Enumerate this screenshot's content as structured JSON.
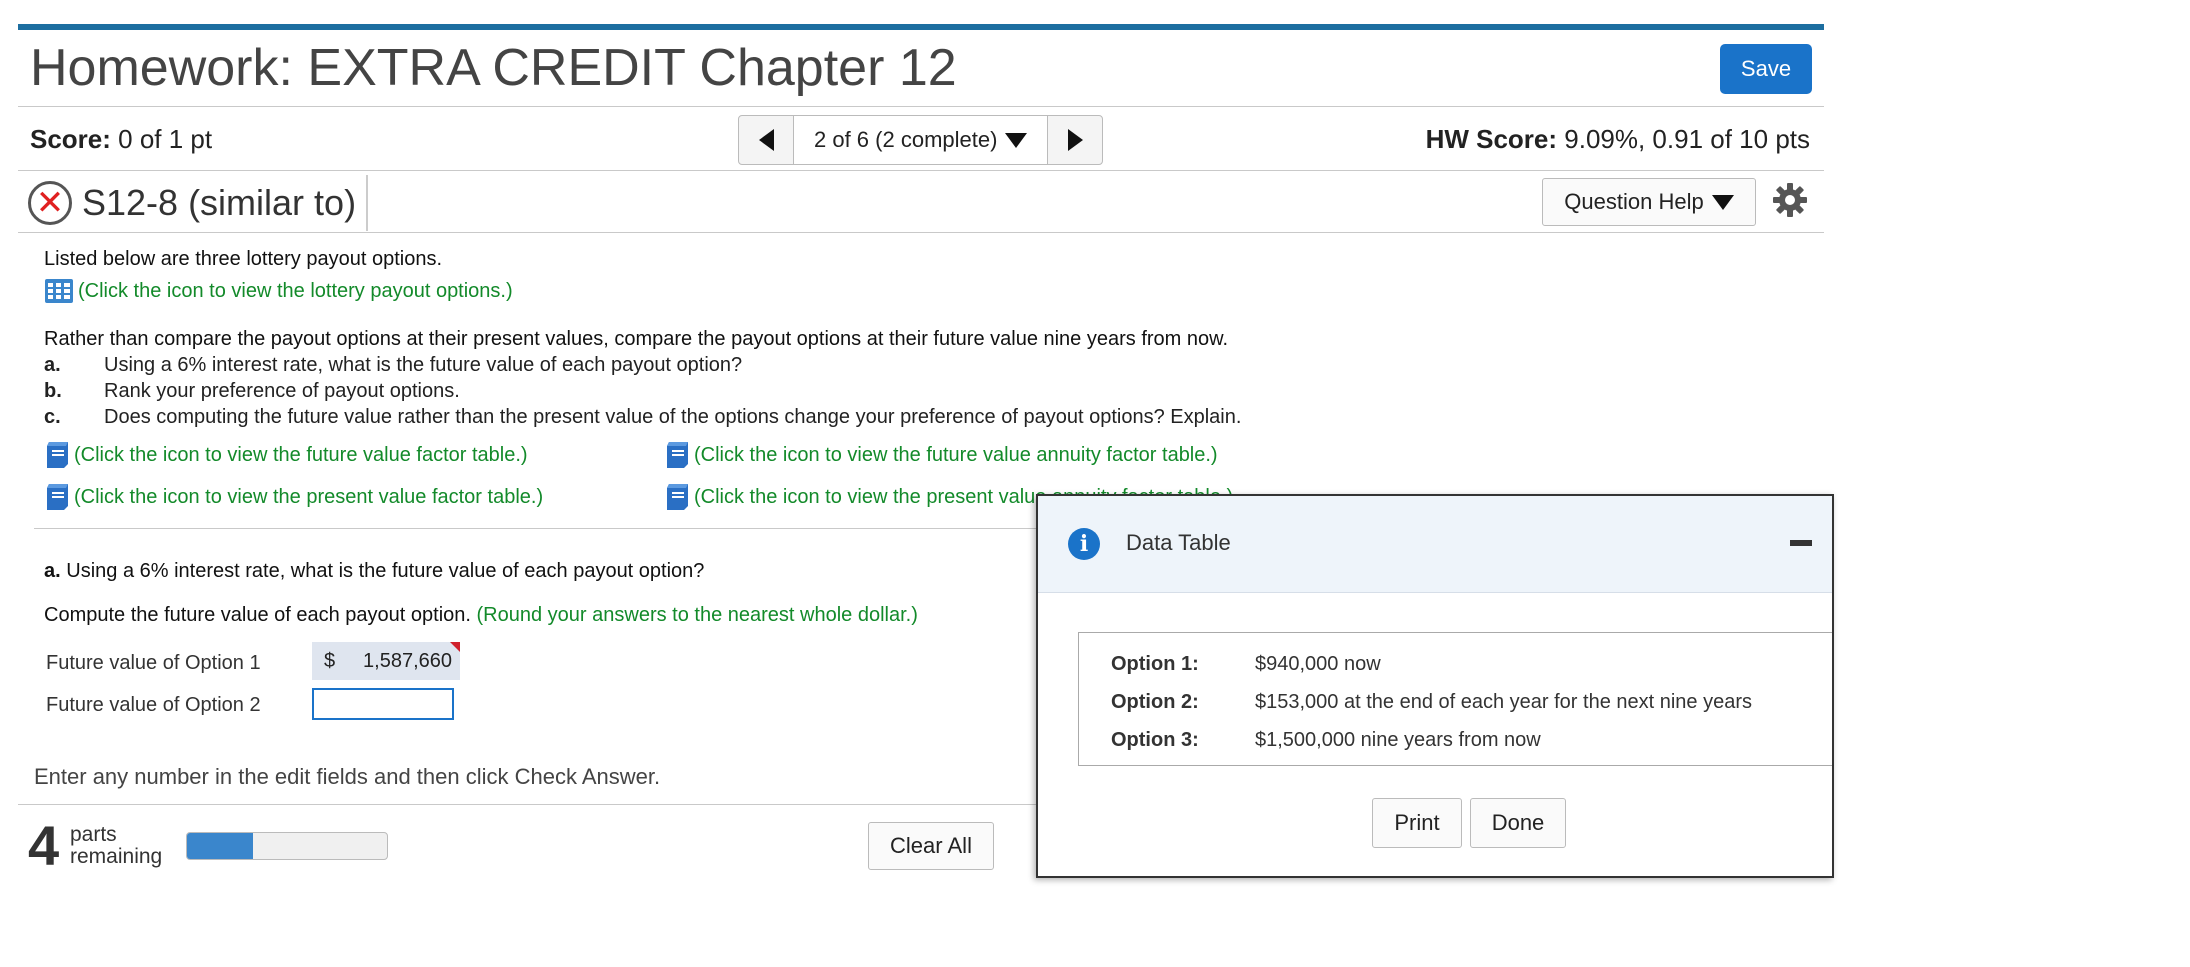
{
  "header": {
    "title": "Homework: EXTRA CREDIT Chapter 12",
    "save_label": "Save"
  },
  "status": {
    "score_label": "Score:",
    "score_value": "0 of 1 pt",
    "nav_label": "2 of 6 (2 complete)",
    "hw_score_label": "HW Score:",
    "hw_score_value": "9.09%, 0.91 of 10 pts"
  },
  "question": {
    "id": "S12-8 (similar to)",
    "help_label": "Question Help",
    "intro": "Listed below are three lottery payout options.",
    "payout_link": "(Click the icon to view the lottery payout options.)",
    "prompt": "Rather than compare the payout options at their present values, compare the payout options at their future value nine years from now.",
    "items": [
      {
        "letter": "a.",
        "text": "Using a 6% interest rate, what is the future value of each payout option?"
      },
      {
        "letter": "b.",
        "text": "Rank your preference of payout options."
      },
      {
        "letter": "c.",
        "text": "Does computing the future value rather than the present value of the options change your preference of payout options? Explain."
      }
    ],
    "table_links": {
      "fv_factor": "(Click the icon to view the future value factor table.)",
      "fva_factor": "(Click the icon to view the future value annuity factor table.)",
      "pv_factor": "(Click the icon to view the present value factor table.)",
      "pva_factor": "(Click the icon to view the present value annuity factor table.)"
    }
  },
  "part_a": {
    "label": "a.",
    "question": "Using a 6% interest rate, what is the future value of each payout option?",
    "instruction": "Compute the future value of each payout option.",
    "instruction_note": "(Round your answers to the nearest whole dollar.)",
    "rows": [
      {
        "label": "Future value of Option 1",
        "currency": "$",
        "value": "1,587,660"
      },
      {
        "label": "Future value of Option 2",
        "currency": "",
        "value": ""
      }
    ]
  },
  "footer": {
    "enter_text": "Enter any number in the edit fields and then click Check Answer.",
    "parts_count": "4",
    "parts_line1": "parts",
    "parts_line2": "remaining",
    "progress_fraction": 0.33,
    "clear_label": "Clear All"
  },
  "popup": {
    "title": "Data Table",
    "options": [
      {
        "label": "Option 1:",
        "value": "$940,000 now"
      },
      {
        "label": "Option 2:",
        "value": "$153,000 at the end of each year for the next nine years"
      },
      {
        "label": "Option 3:",
        "value": "$1,500,000 nine years from now"
      }
    ],
    "print_label": "Print",
    "done_label": "Done"
  },
  "colors": {
    "accent": "#1a73c9",
    "link_green": "#138a2a",
    "error_red": "#e02020",
    "top_bar": "#1d6ea0"
  }
}
